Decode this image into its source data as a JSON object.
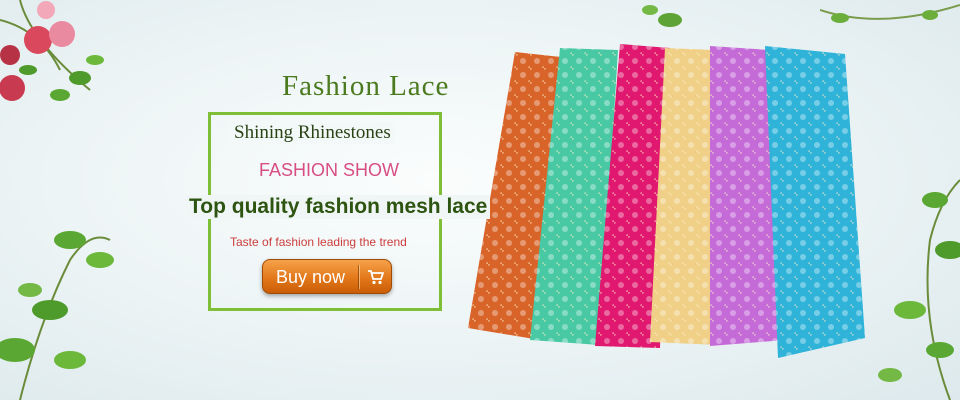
{
  "banner": {
    "title": "Fashion Lace",
    "tagline": "Shining Rhinestones",
    "show_label": "FASHION SHOW",
    "headline": "Top quality fashion mesh lace",
    "slogan": "Taste of fashion  leading the trend",
    "buy_button": {
      "label": "Buy now",
      "icon": "cart-icon"
    }
  },
  "colors": {
    "frame": "#7fbf38",
    "title": "#4b7a1f",
    "show_label": "#d74e84",
    "slogan": "#cc3d3d",
    "button": "#e2781a"
  },
  "fabrics": [
    {
      "name": "orange-lace",
      "color": "#d9642a"
    },
    {
      "name": "mint-lace",
      "color": "#48c9a4"
    },
    {
      "name": "fuchsia-lace",
      "color": "#e0186f"
    },
    {
      "name": "cream-lace",
      "color": "#f0cf86"
    },
    {
      "name": "lilac-lace",
      "color": "#c56bd8"
    },
    {
      "name": "turquoise-lace",
      "color": "#2fb3d9"
    }
  ]
}
